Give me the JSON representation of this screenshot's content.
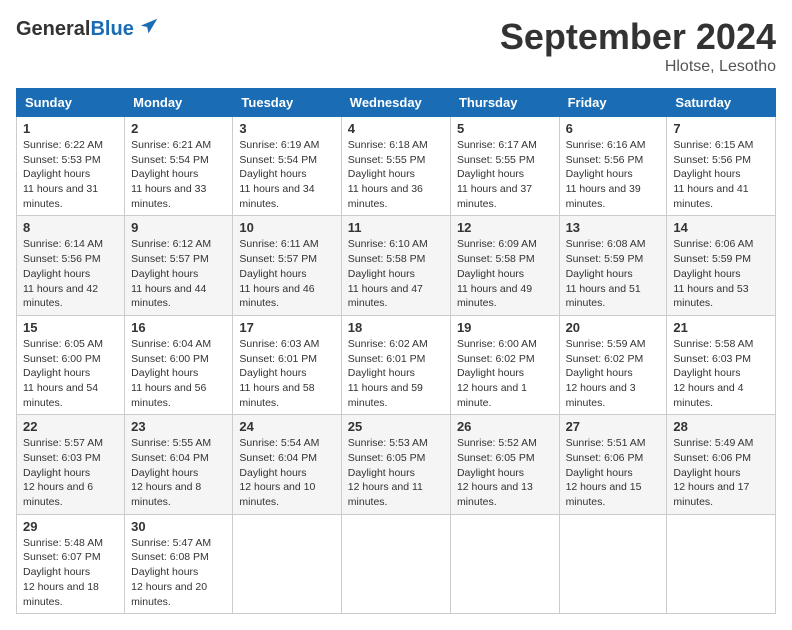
{
  "header": {
    "logo_general": "General",
    "logo_blue": "Blue",
    "title": "September 2024",
    "subtitle": "Hlotse, Lesotho"
  },
  "weekdays": [
    "Sunday",
    "Monday",
    "Tuesday",
    "Wednesday",
    "Thursday",
    "Friday",
    "Saturday"
  ],
  "weeks": [
    [
      {
        "day": "1",
        "sunrise": "6:22 AM",
        "sunset": "5:53 PM",
        "daylight": "11 hours and 31 minutes."
      },
      {
        "day": "2",
        "sunrise": "6:21 AM",
        "sunset": "5:54 PM",
        "daylight": "11 hours and 33 minutes."
      },
      {
        "day": "3",
        "sunrise": "6:19 AM",
        "sunset": "5:54 PM",
        "daylight": "11 hours and 34 minutes."
      },
      {
        "day": "4",
        "sunrise": "6:18 AM",
        "sunset": "5:55 PM",
        "daylight": "11 hours and 36 minutes."
      },
      {
        "day": "5",
        "sunrise": "6:17 AM",
        "sunset": "5:55 PM",
        "daylight": "11 hours and 37 minutes."
      },
      {
        "day": "6",
        "sunrise": "6:16 AM",
        "sunset": "5:56 PM",
        "daylight": "11 hours and 39 minutes."
      },
      {
        "day": "7",
        "sunrise": "6:15 AM",
        "sunset": "5:56 PM",
        "daylight": "11 hours and 41 minutes."
      }
    ],
    [
      {
        "day": "8",
        "sunrise": "6:14 AM",
        "sunset": "5:56 PM",
        "daylight": "11 hours and 42 minutes."
      },
      {
        "day": "9",
        "sunrise": "6:12 AM",
        "sunset": "5:57 PM",
        "daylight": "11 hours and 44 minutes."
      },
      {
        "day": "10",
        "sunrise": "6:11 AM",
        "sunset": "5:57 PM",
        "daylight": "11 hours and 46 minutes."
      },
      {
        "day": "11",
        "sunrise": "6:10 AM",
        "sunset": "5:58 PM",
        "daylight": "11 hours and 47 minutes."
      },
      {
        "day": "12",
        "sunrise": "6:09 AM",
        "sunset": "5:58 PM",
        "daylight": "11 hours and 49 minutes."
      },
      {
        "day": "13",
        "sunrise": "6:08 AM",
        "sunset": "5:59 PM",
        "daylight": "11 hours and 51 minutes."
      },
      {
        "day": "14",
        "sunrise": "6:06 AM",
        "sunset": "5:59 PM",
        "daylight": "11 hours and 53 minutes."
      }
    ],
    [
      {
        "day": "15",
        "sunrise": "6:05 AM",
        "sunset": "6:00 PM",
        "daylight": "11 hours and 54 minutes."
      },
      {
        "day": "16",
        "sunrise": "6:04 AM",
        "sunset": "6:00 PM",
        "daylight": "11 hours and 56 minutes."
      },
      {
        "day": "17",
        "sunrise": "6:03 AM",
        "sunset": "6:01 PM",
        "daylight": "11 hours and 58 minutes."
      },
      {
        "day": "18",
        "sunrise": "6:02 AM",
        "sunset": "6:01 PM",
        "daylight": "11 hours and 59 minutes."
      },
      {
        "day": "19",
        "sunrise": "6:00 AM",
        "sunset": "6:02 PM",
        "daylight": "12 hours and 1 minute."
      },
      {
        "day": "20",
        "sunrise": "5:59 AM",
        "sunset": "6:02 PM",
        "daylight": "12 hours and 3 minutes."
      },
      {
        "day": "21",
        "sunrise": "5:58 AM",
        "sunset": "6:03 PM",
        "daylight": "12 hours and 4 minutes."
      }
    ],
    [
      {
        "day": "22",
        "sunrise": "5:57 AM",
        "sunset": "6:03 PM",
        "daylight": "12 hours and 6 minutes."
      },
      {
        "day": "23",
        "sunrise": "5:55 AM",
        "sunset": "6:04 PM",
        "daylight": "12 hours and 8 minutes."
      },
      {
        "day": "24",
        "sunrise": "5:54 AM",
        "sunset": "6:04 PM",
        "daylight": "12 hours and 10 minutes."
      },
      {
        "day": "25",
        "sunrise": "5:53 AM",
        "sunset": "6:05 PM",
        "daylight": "12 hours and 11 minutes."
      },
      {
        "day": "26",
        "sunrise": "5:52 AM",
        "sunset": "6:05 PM",
        "daylight": "12 hours and 13 minutes."
      },
      {
        "day": "27",
        "sunrise": "5:51 AM",
        "sunset": "6:06 PM",
        "daylight": "12 hours and 15 minutes."
      },
      {
        "day": "28",
        "sunrise": "5:49 AM",
        "sunset": "6:06 PM",
        "daylight": "12 hours and 17 minutes."
      }
    ],
    [
      {
        "day": "29",
        "sunrise": "5:48 AM",
        "sunset": "6:07 PM",
        "daylight": "12 hours and 18 minutes."
      },
      {
        "day": "30",
        "sunrise": "5:47 AM",
        "sunset": "6:08 PM",
        "daylight": "12 hours and 20 minutes."
      },
      null,
      null,
      null,
      null,
      null
    ]
  ]
}
